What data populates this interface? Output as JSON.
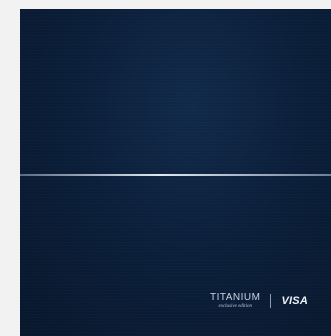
{
  "card": {
    "tier_word": "TITANIUM",
    "tier_subtitle": "exclusive edition",
    "network": "VISA"
  },
  "colors": {
    "page_background": "#f2f2f2",
    "card_background": "#0b1f3a",
    "divider": "#dfe7f2",
    "text": "#c9d4e6"
  }
}
